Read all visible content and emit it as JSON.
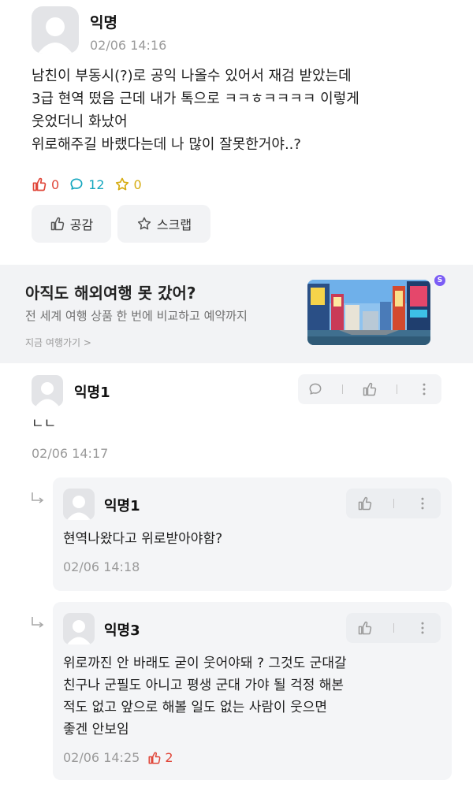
{
  "post": {
    "author": "익명",
    "time": "02/06 14:16",
    "body_lines": [
      "남친이 부동시(?)로 공익 나올수 있어서 재검 받았는데",
      "3급 현역 떴음 근데 내가 톡으로 ㅋㅋㅎㅋㅋㅋㅋ 이렇게",
      "웃었더니 화났어",
      "위로해주길 바랬다는데 나 많이 잘못한거야..?"
    ],
    "likes": "0",
    "comments": "12",
    "scraps": "0",
    "empathy_label": "공감",
    "scrap_label": "스크랩"
  },
  "ad": {
    "title": "아직도 해외여행 못 갔어?",
    "subtitle": "전 세계 여행 상품 한 번에 비교하고 예약까지",
    "link": "지금 여행가기 >",
    "badge": "S"
  },
  "comments": [
    {
      "author": "익명1",
      "text_lines": [
        "ㄴㄴ"
      ],
      "time": "02/06 14:17"
    }
  ],
  "replies": [
    {
      "author": "익명1",
      "text_lines": [
        "현역나왔다고 위로받아야함?"
      ],
      "time": "02/06 14:18"
    },
    {
      "author": "익명3",
      "text_lines": [
        "위로까진 안 바래도 굳이 웃어야돼 ? 그것도 군대갈",
        "친구나 군필도 아니고 평생 군대 가야 될 걱정 해본",
        "적도 없고 앞으로 해볼 일도 없는 사람이 웃으면",
        "좋겐 안보임"
      ],
      "time": "02/06 14:25",
      "likes": "2"
    }
  ],
  "colors": {
    "like": "#e0473a",
    "comment": "#16a7bf",
    "scrap": "#d6ac12",
    "card_bg": "#f4f5f7"
  }
}
